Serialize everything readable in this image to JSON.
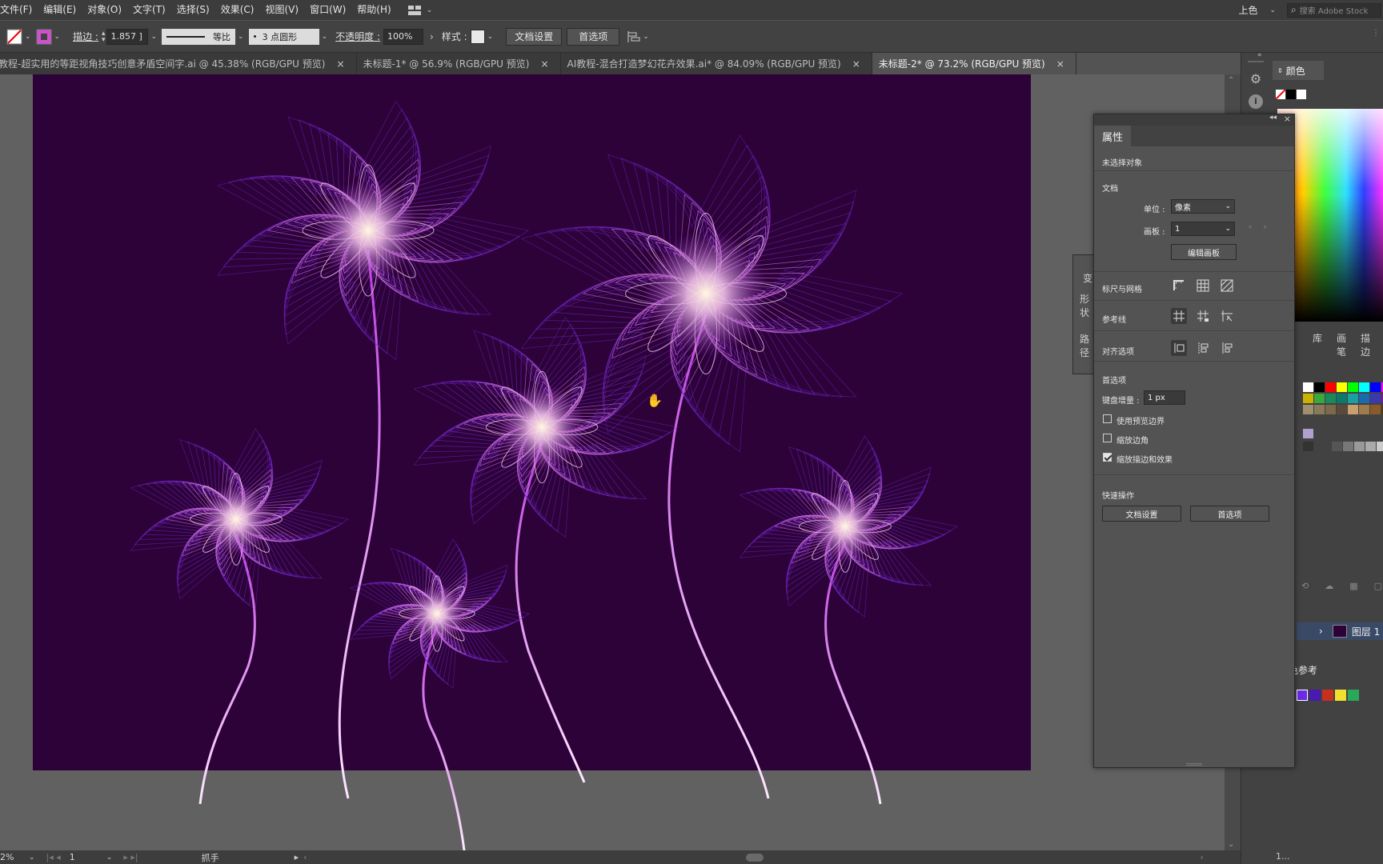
{
  "menu": {
    "items": [
      "文件(F)",
      "编辑(E)",
      "对象(O)",
      "文字(T)",
      "选择(S)",
      "效果(C)",
      "视图(V)",
      "窗口(W)",
      "帮助(H)"
    ],
    "workspace": "上色",
    "search_placeholder": "搜索 Adobe Stock"
  },
  "control": {
    "stroke_label": "描边 :",
    "stroke_value": "1.857 ]",
    "profile": "等比",
    "brush": "3 点圆形",
    "opacity_label": "不透明度 :",
    "opacity_value": "100%",
    "style_label": "样式 :",
    "doc_setup": "文档设置",
    "prefs": "首选项"
  },
  "tabs": [
    {
      "label": "教程-超实用的等距视角技巧创意矛盾空间字.ai @ 45.38% (RGB/GPU 预览)",
      "close": "×"
    },
    {
      "label": "未标题-1* @ 56.9% (RGB/GPU 预览)",
      "close": "×"
    },
    {
      "label": "AI教程-混合打造梦幻花卉效果.ai* @ 84.09% (RGB/GPU 预览)",
      "close": "×"
    },
    {
      "label": "未标题-2* @ 73.2% (RGB/GPU 预览)",
      "close": "×"
    }
  ],
  "status": {
    "zoom": "2%",
    "artboard": "1",
    "tool": "抓手"
  },
  "dock": {
    "color_tab": "颜色",
    "tabs2": [
      "库",
      "画笔",
      "描边"
    ],
    "layer_name": "图层 1",
    "ref_tab": "色参考",
    "bottom_text": "1..."
  },
  "hidden_panel": {
    "labels": [
      "变",
      "形状",
      "路径"
    ]
  },
  "properties": {
    "tab": "属性",
    "no_selection": "未选择对象",
    "doc_section": "文档",
    "unit_label": "单位 :",
    "unit_value": "像素",
    "artboard_label": "画板 :",
    "artboard_value": "1",
    "edit_artboard": "编辑画板",
    "rulers_label": "标尺与网格",
    "guides_label": "参考线",
    "align_label": "对齐选项",
    "prefs_section": "首选项",
    "keyboard_increment_label": "键盘增量 :",
    "keyboard_increment_value": "1 px",
    "use_preview_bounds": "使用预览边界",
    "scale_corners": "缩放边角",
    "scale_strokes": "缩放描边和效果",
    "use_preview_bounds_checked": false,
    "scale_corners_checked": false,
    "scale_strokes_checked": true,
    "quick_actions": "快速操作",
    "qa_doc_setup": "文档设置",
    "qa_prefs": "首选项"
  }
}
